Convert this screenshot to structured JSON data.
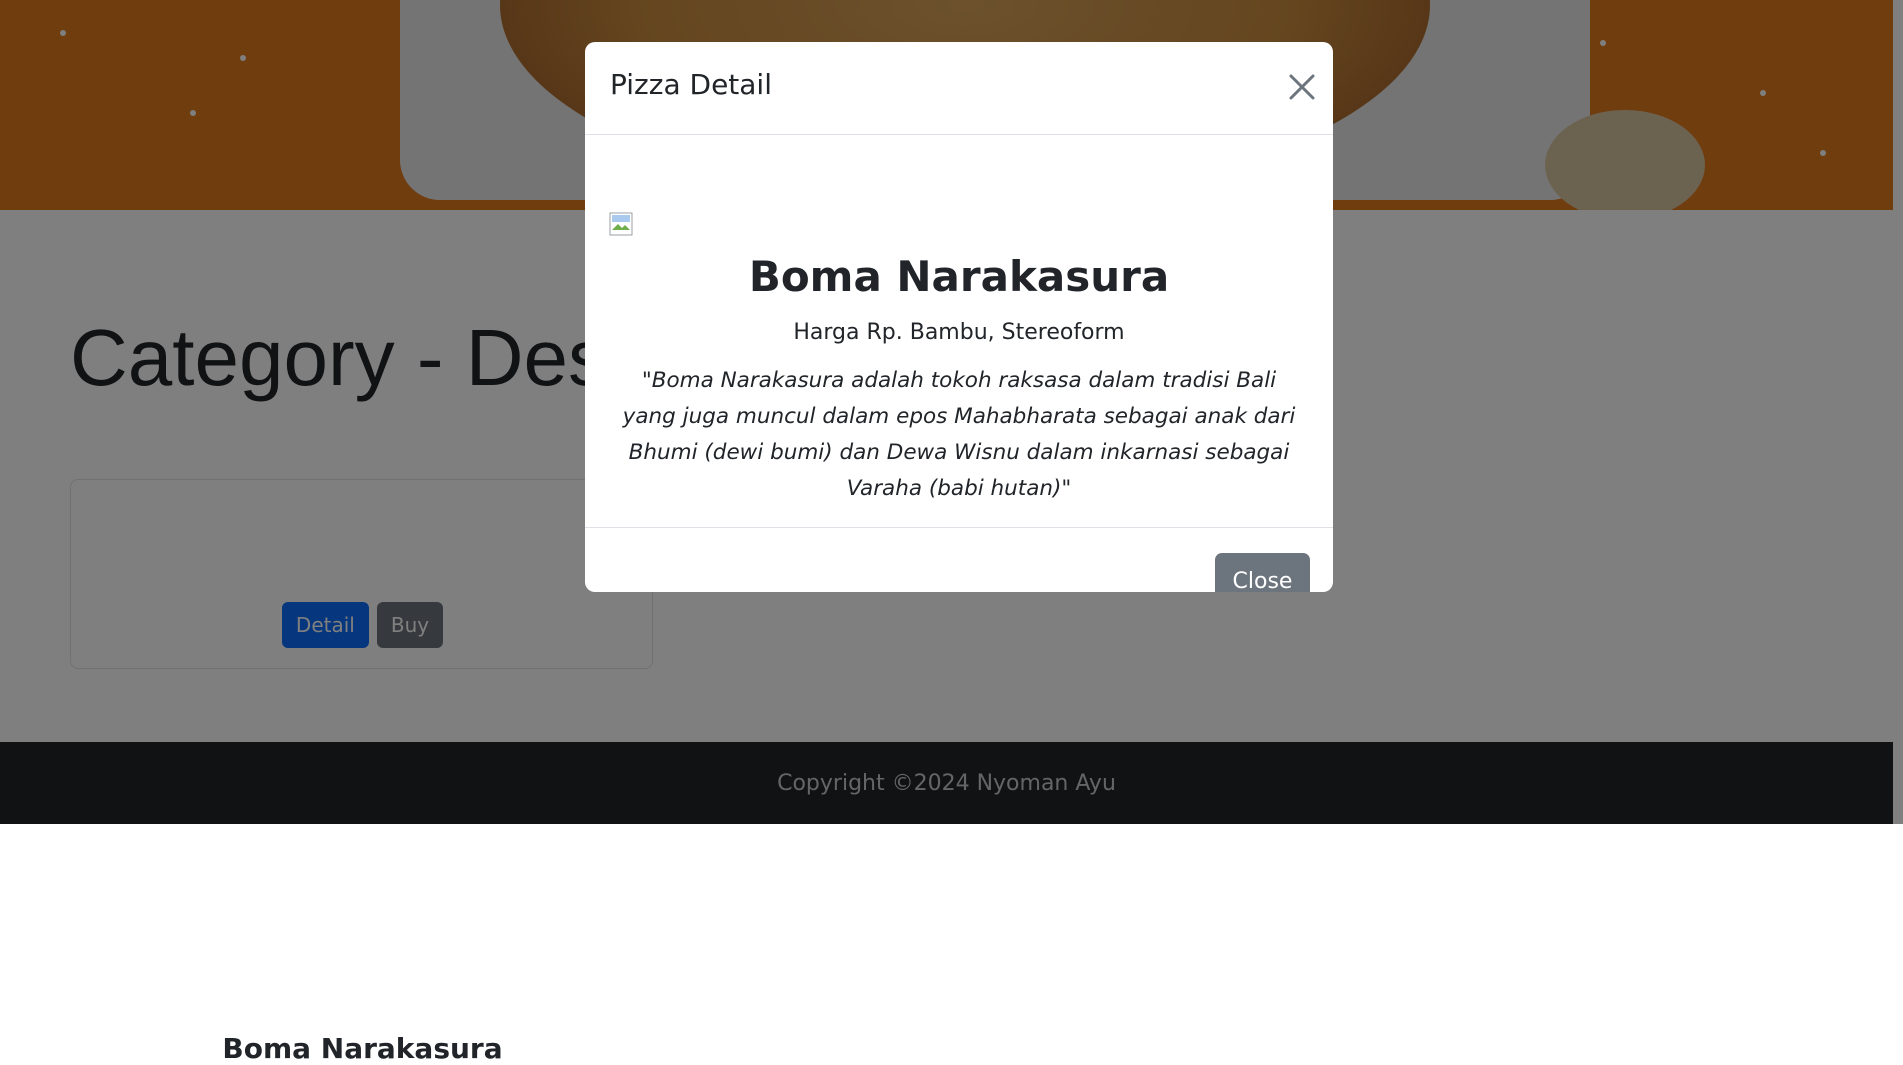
{
  "page": {
    "title": "Category - Dessert",
    "footer_text": "Copyright ©2024 Nyoman Ayu"
  },
  "card": {
    "name": "Boma Narakasura",
    "detail_label": "Detail",
    "buy_label": "Buy"
  },
  "modal": {
    "title": "Pizza Detail",
    "pizza_name": "Boma Narakasura",
    "price_text": "Harga Rp. Bambu, Stereoform",
    "description": "\"Boma Narakasura adalah tokoh raksasa dalam tradisi Bali yang juga muncul dalam epos Mahabharata sebagai anak dari Bhumi (dewi bumi) dan Dewa Wisnu dalam inkarnasi sebagai Varaha (babi hutan)\"",
    "close_label": "Close"
  },
  "colors": {
    "primary": "#0d6efd",
    "secondary": "#6c757d",
    "footer_bg": "#212529",
    "hero_orange": "#e07a1f"
  },
  "icons": {
    "close": "close-x-icon",
    "broken_image": "broken-image-icon"
  }
}
